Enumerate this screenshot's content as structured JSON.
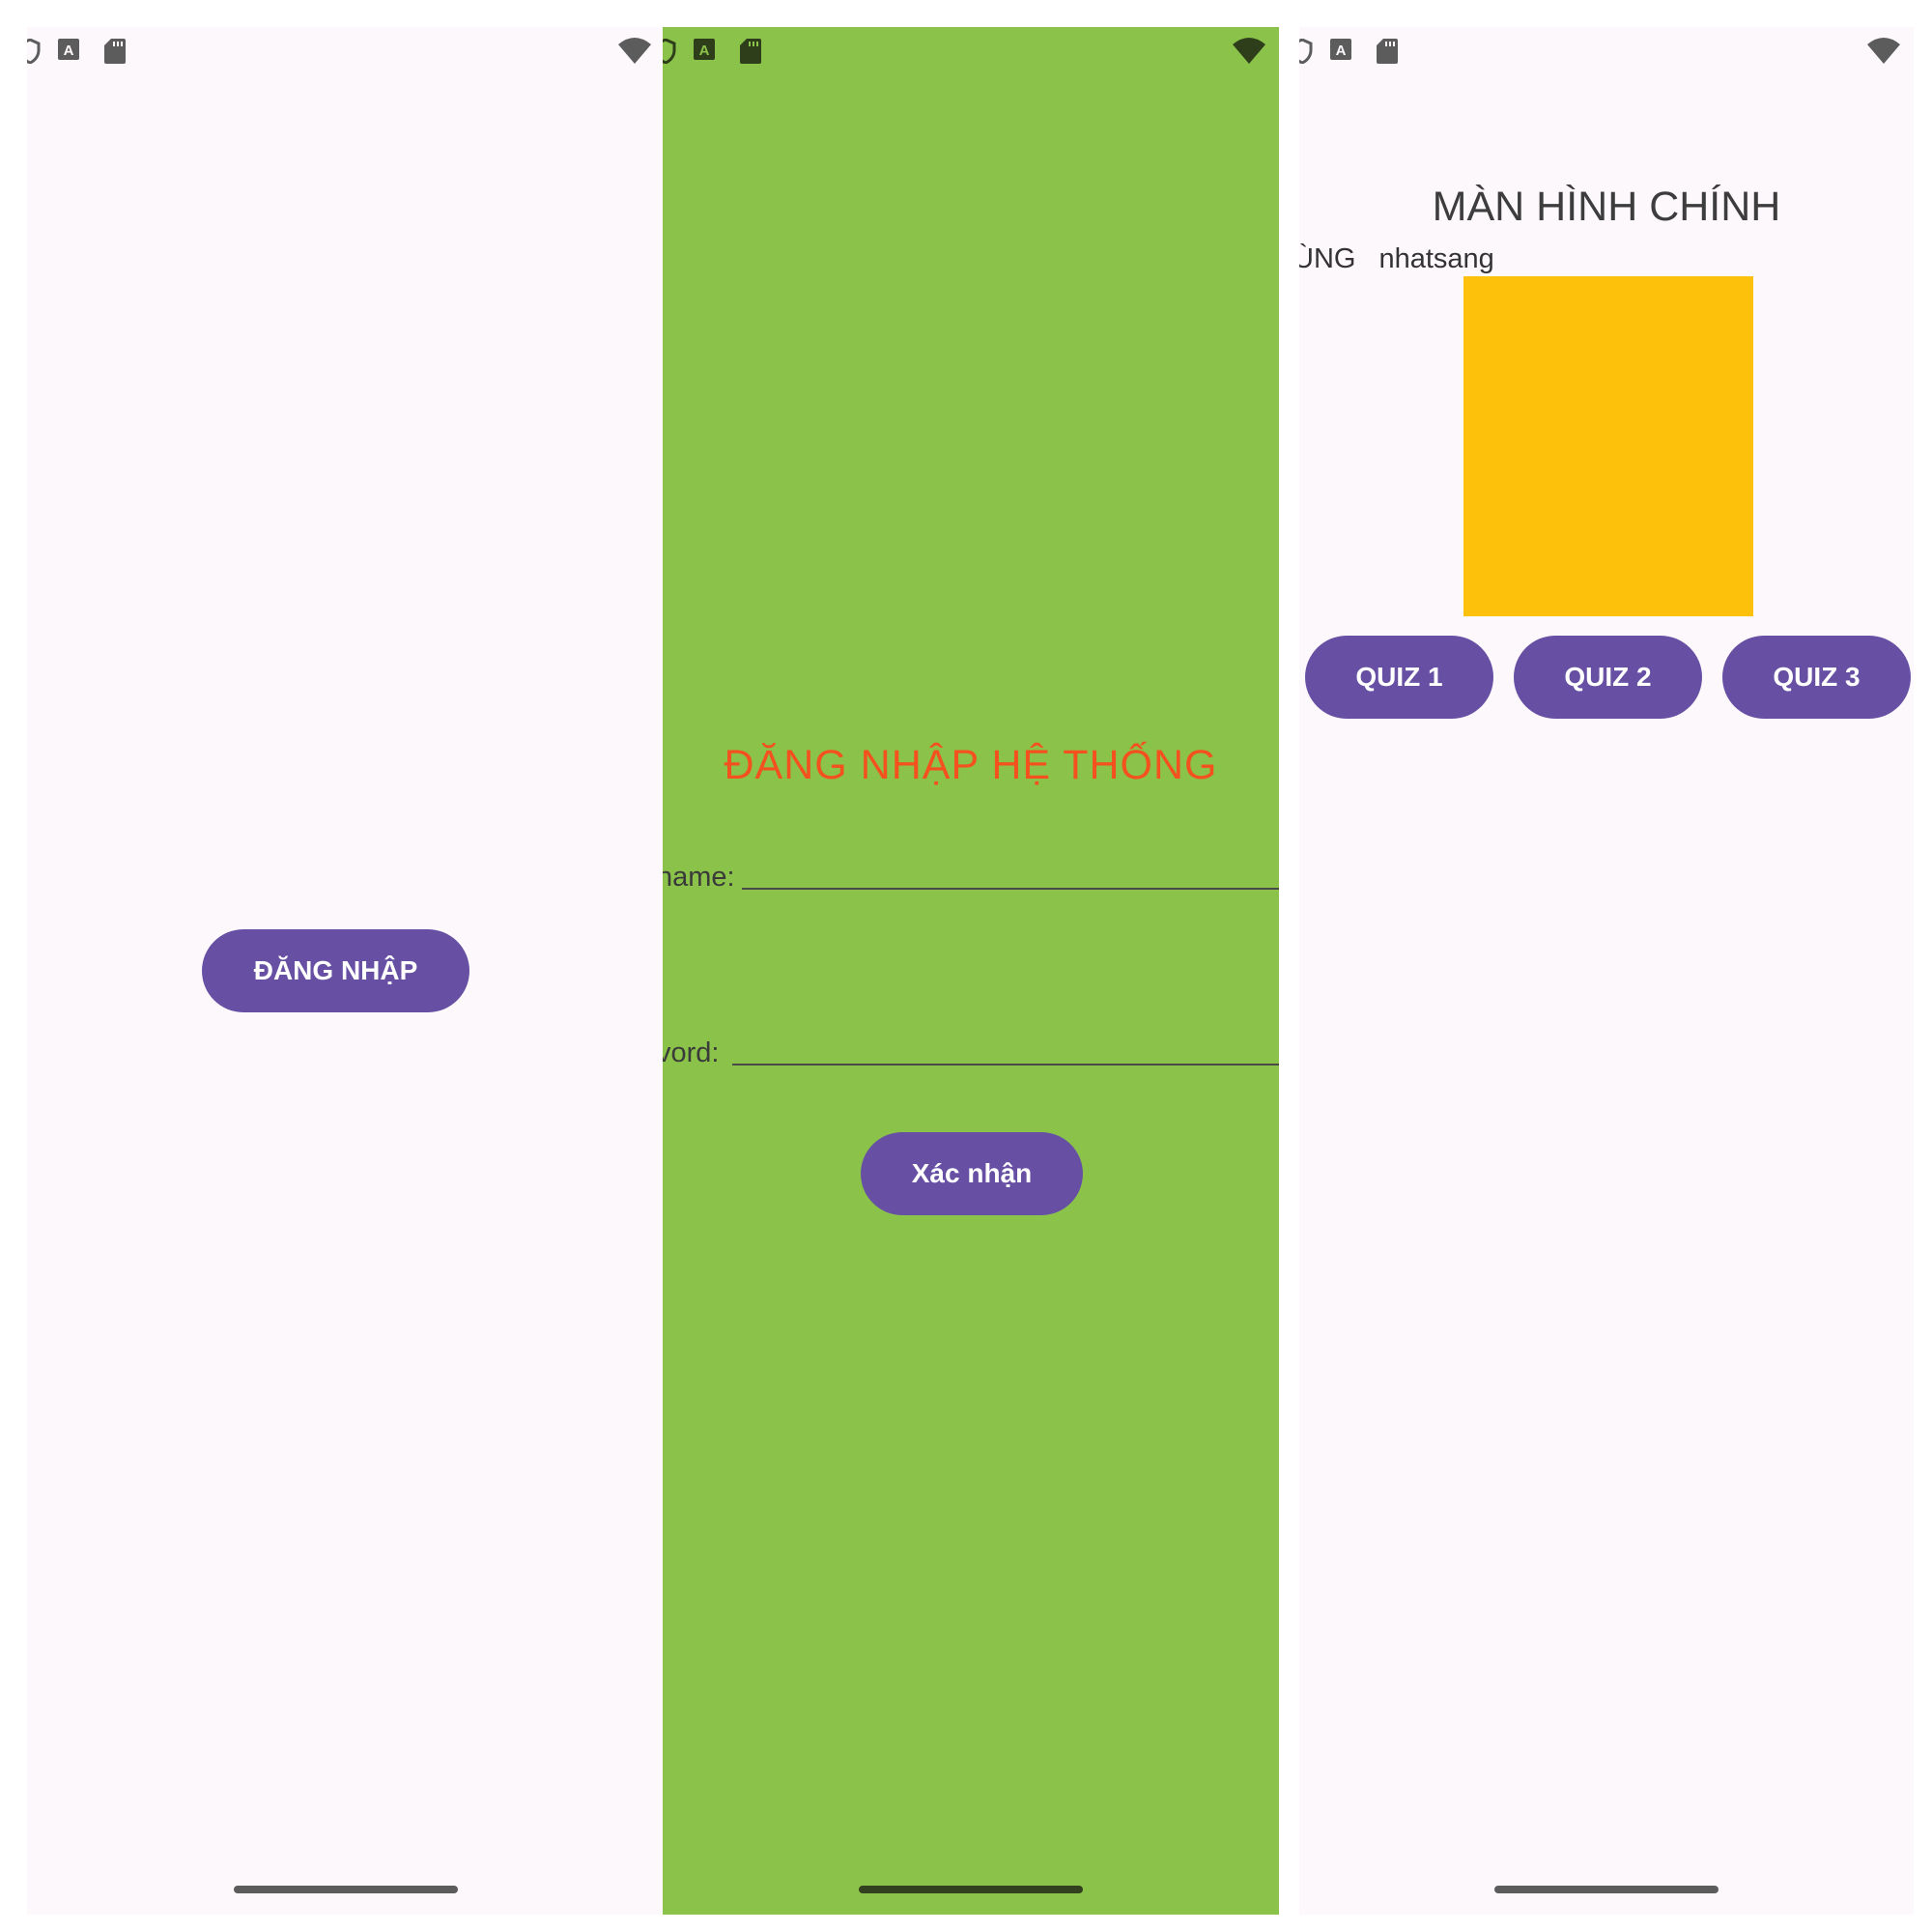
{
  "screens": [
    {
      "id": "start",
      "background": "#fdf8fc",
      "login_button_label": "ĐĂNG NHẬP"
    },
    {
      "id": "login",
      "background": "#8bc34a",
      "title": "ĐĂNG NHẬP HỆ THỐNG",
      "title_color": "#f4511e",
      "username_label": "name:",
      "username_value": "",
      "password_label": "vord:",
      "password_value": "",
      "confirm_label": "Xác nhận"
    },
    {
      "id": "main",
      "background": "#fdf8fc",
      "title": "MÀN HÌNH CHÍNH",
      "welcome_prefix": "ÙNG",
      "username": "nhatsang",
      "image_color": "#fdc00b",
      "quiz_buttons": [
        "QUIZ 1",
        "QUIZ 2",
        "QUIZ 3"
      ]
    }
  ],
  "status_icons": [
    "shield-icon",
    "font-icon",
    "sd-card-icon",
    "wifi-icon"
  ],
  "accent": "#6750a4"
}
